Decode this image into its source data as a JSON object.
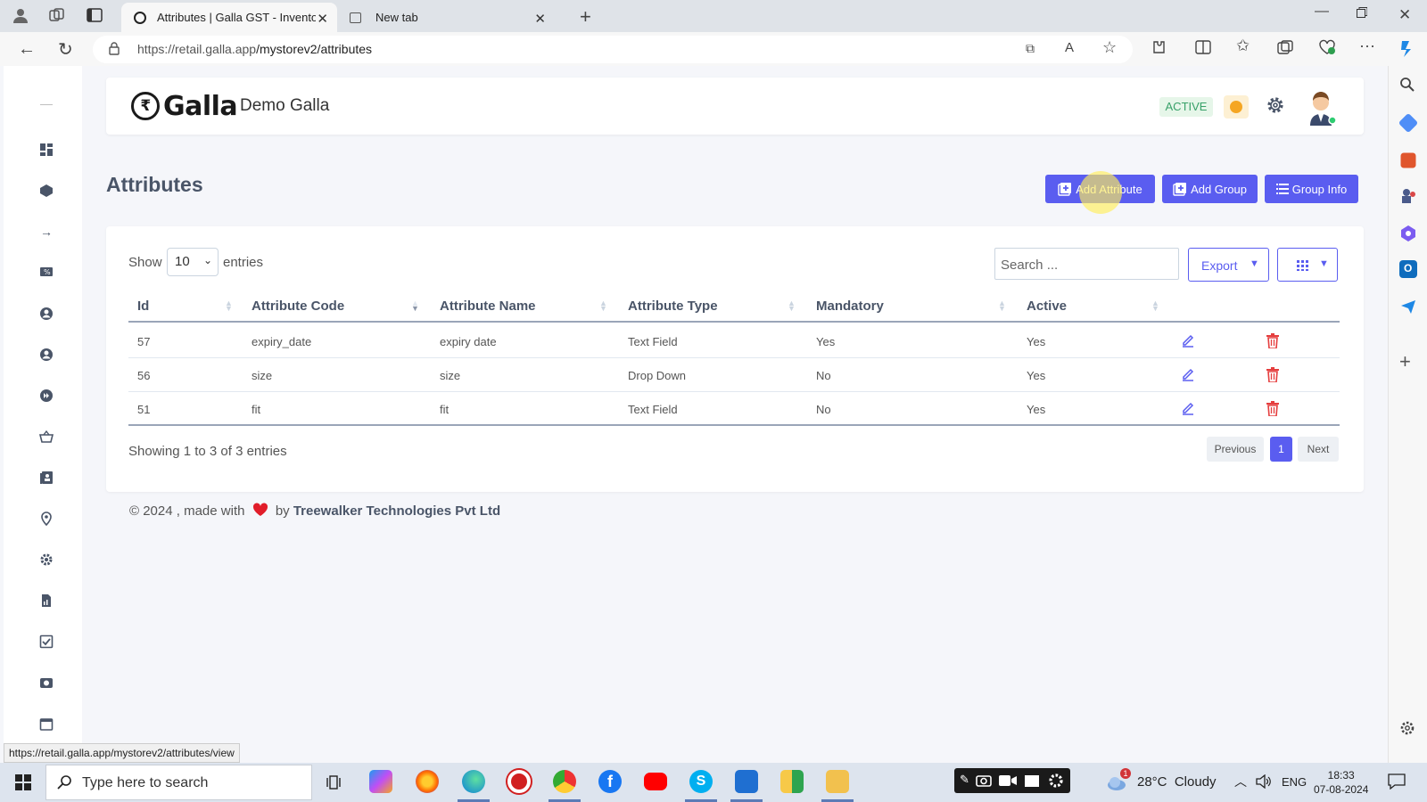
{
  "browser": {
    "tabs": [
      {
        "label": "Attributes | Galla GST - Inventory",
        "active": true
      },
      {
        "label": "New tab",
        "active": false
      }
    ],
    "url_host": "https://retail.galla.app",
    "url_path": "/mystorev2/attributes",
    "status_url": "https://retail.galla.app/mystorev2/attributes/view"
  },
  "header": {
    "logo_text": "Galla",
    "store_name": "Demo Galla",
    "status_badge": "ACTIVE"
  },
  "page": {
    "title": "Attributes",
    "buttons": {
      "add_attribute": "Add Attribute",
      "add_group": "Add Group",
      "group_info": "Group Info"
    }
  },
  "table": {
    "show_label": "Show",
    "page_size": "10",
    "entries_label": "entries",
    "search_placeholder": "Search ...",
    "export_label": "Export",
    "columns": [
      "Id",
      "Attribute Code",
      "Attribute Name",
      "Attribute Type",
      "Mandatory",
      "Active"
    ],
    "rows": [
      {
        "id": "57",
        "code": "expiry_date",
        "name": "expiry date",
        "type": "Text Field",
        "mandatory": "Yes",
        "active": "Yes"
      },
      {
        "id": "56",
        "code": "size",
        "name": "size",
        "type": "Drop Down",
        "mandatory": "No",
        "active": "Yes"
      },
      {
        "id": "51",
        "code": "fit",
        "name": "fit",
        "type": "Text Field",
        "mandatory": "No",
        "active": "Yes"
      }
    ],
    "info": "Showing 1 to 3 of 3 entries",
    "pagination": {
      "previous": "Previous",
      "current": "1",
      "next": "Next"
    }
  },
  "footer": {
    "prefix": "© 2024 , made with",
    "by": "by",
    "company": "Treewalker Technologies Pvt Ltd"
  },
  "taskbar": {
    "search_placeholder": "Type here to search",
    "weather": "28°C  Cloudy",
    "weather_badge": "1",
    "lang": "ENG",
    "time": "18:33",
    "date": "07-08-2024"
  },
  "colors": {
    "primary": "#5a5df0",
    "active_green": "#38a169",
    "delete_red": "#e53e3e",
    "heart": "#e11d2a"
  }
}
